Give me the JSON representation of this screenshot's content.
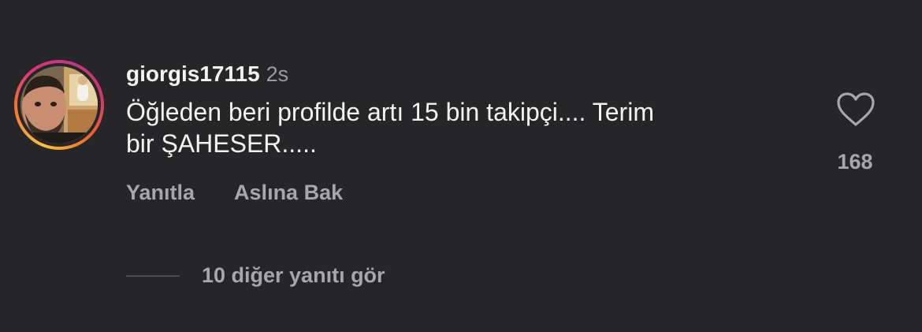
{
  "comment": {
    "username": "giorgis17115",
    "time": "2s",
    "text_lines": [
      "Öğleden beri profilde artı 15 bin takipçi.... Terim",
      "bir ŞAHESER....."
    ],
    "like_count": "168"
  },
  "actions": {
    "reply_label": "Yanıtla",
    "see_original_label": "Aslına Bak"
  },
  "replies": {
    "view_more_label": "10 diğer yanıtı gör"
  },
  "icons": {
    "like": "heart-outline-icon",
    "avatar": "profile-photo"
  },
  "colors": {
    "background": "#262629",
    "primary_text": "#f2f2f2",
    "secondary_text": "#a6a6ab",
    "story_ring": [
      "#f9c33a",
      "#f77b29",
      "#e2337b",
      "#c13584"
    ]
  }
}
